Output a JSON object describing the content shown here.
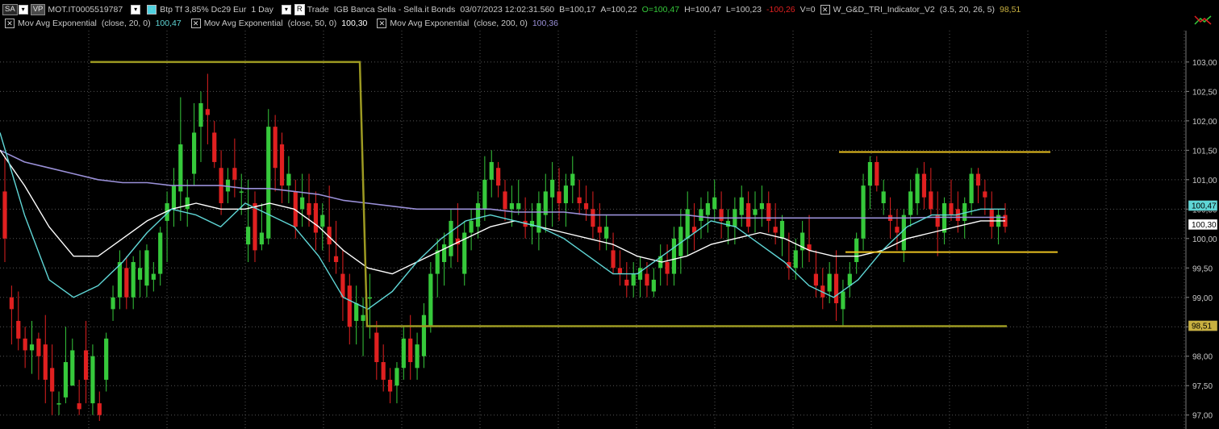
{
  "header": {
    "sa_button": "SA",
    "vp_button": "VP",
    "symbol": "MOT.IT0005519787",
    "instrument": "Btp Tf 3,85% Dc29 Eur",
    "interval": "1 Day",
    "r_button": "R",
    "trade_label": "Trade",
    "source": "IGB  Banca Sella - Sella.it  Bonds",
    "datetime": "03/07/2023   12:02:31.560",
    "bid": "B=100,17",
    "ask": "A=100,22",
    "open": "O=100,47",
    "high": "H=100,47",
    "low": "L=100,23",
    "change": "-100,26",
    "volume": "V=0",
    "indicator_name": "W_G&D_TRI_Indicator_V2",
    "indicator_params": "(3.5,  20,  26,  5)",
    "indicator_value": "98,51"
  },
  "indicators": [
    {
      "name": "Mov Avg Exponential",
      "params": "(close,  20,  0)",
      "value": "100,47",
      "color": "#5fd6d6"
    },
    {
      "name": "Mov Avg Exponential",
      "params": "(close,  50,  0)",
      "value": "100,30",
      "color": "#ffffff"
    },
    {
      "name": "Mov Avg Exponential",
      "params": "(close,  200,  0)",
      "value": "100,36",
      "color": "#9a90d8"
    }
  ],
  "price_badges": [
    {
      "value": "100,47",
      "bg": "#5fd6d6"
    },
    {
      "value": "100,30",
      "bg": "#ffffff"
    },
    {
      "value": "98,51",
      "bg": "#c8b040"
    }
  ],
  "chart_data": {
    "type": "candlestick",
    "ylim": [
      96.9,
      103.3
    ],
    "y_ticks": [
      "97,00",
      "97,50",
      "98,00",
      "98,50",
      "99,00",
      "99,50",
      "100,00",
      "100,50",
      "101,00",
      "101,50",
      "102,00",
      "102,50",
      "103,00"
    ],
    "candles": [
      [
        100.8,
        101.4,
        99.6,
        100.0
      ],
      [
        99.0,
        99.2,
        98.2,
        98.8
      ],
      [
        98.6,
        99.1,
        98.1,
        98.3
      ],
      [
        98.3,
        98.5,
        97.8,
        98.1
      ],
      [
        98.1,
        98.6,
        97.7,
        98.2
      ],
      [
        98.3,
        98.4,
        97.6,
        98.0
      ],
      [
        98.2,
        98.7,
        97.2,
        97.6
      ],
      [
        97.8,
        98.2,
        97.0,
        97.4
      ],
      [
        97.2,
        97.4,
        97.0,
        97.2
      ],
      [
        97.3,
        98.5,
        97.2,
        97.9
      ],
      [
        97.5,
        98.3,
        97.5,
        98.1
      ],
      [
        97.2,
        97.6,
        97.0,
        97.1
      ],
      [
        98.1,
        98.6,
        97.2,
        97.6
      ],
      [
        97.2,
        98.2,
        97.0,
        98.0
      ],
      [
        97.2,
        97.4,
        96.9,
        97.0
      ],
      [
        97.6,
        98.4,
        97.4,
        98.3
      ],
      [
        98.8,
        99.2,
        98.6,
        99.0
      ],
      [
        99.0,
        99.8,
        98.8,
        99.6
      ],
      [
        99.5,
        99.7,
        98.8,
        99.0
      ],
      [
        99.0,
        99.7,
        98.8,
        99.6
      ],
      [
        99.3,
        99.8,
        99.0,
        99.5
      ],
      [
        99.2,
        99.9,
        99.0,
        99.8
      ],
      [
        99.3,
        99.6,
        99.1,
        99.4
      ],
      [
        99.4,
        100.2,
        99.2,
        100.1
      ],
      [
        100.3,
        100.8,
        99.6,
        100.6
      ],
      [
        100.5,
        101.2,
        100.2,
        100.9
      ],
      [
        100.8,
        102.4,
        100.3,
        101.6
      ],
      [
        100.5,
        101.0,
        100.2,
        100.7
      ],
      [
        101.1,
        102.3,
        100.9,
        101.8
      ],
      [
        101.9,
        102.5,
        101.3,
        102.3
      ],
      [
        102.2,
        102.8,
        101.6,
        102.1
      ],
      [
        101.8,
        102.0,
        101.2,
        101.3
      ],
      [
        101.2,
        101.5,
        100.4,
        100.6
      ],
      [
        100.8,
        101.2,
        100.6,
        101.0
      ],
      [
        101.2,
        101.7,
        100.7,
        101.0
      ],
      [
        100.8,
        101.1,
        100.4,
        100.8
      ],
      [
        99.9,
        101.0,
        99.6,
        100.2
      ],
      [
        100.6,
        100.8,
        99.6,
        99.8
      ],
      [
        99.9,
        100.6,
        99.8,
        100.1
      ],
      [
        100.0,
        102.2,
        99.9,
        101.9
      ],
      [
        101.9,
        102.1,
        100.8,
        101.2
      ],
      [
        101.6,
        101.8,
        100.6,
        100.9
      ],
      [
        100.9,
        101.4,
        100.6,
        101.1
      ],
      [
        100.8,
        101.0,
        100.0,
        100.2
      ],
      [
        100.5,
        101.1,
        100.2,
        100.7
      ],
      [
        100.6,
        101.1,
        100.2,
        100.4
      ],
      [
        100.6,
        100.8,
        99.8,
        100.1
      ],
      [
        100.2,
        100.6,
        99.8,
        100.4
      ],
      [
        100.2,
        100.9,
        99.6,
        99.9
      ],
      [
        99.7,
        100.3,
        99.4,
        99.6
      ],
      [
        99.4,
        99.8,
        98.6,
        99.0
      ],
      [
        99.2,
        99.4,
        98.2,
        98.5
      ],
      [
        98.6,
        99.2,
        98.2,
        98.9
      ],
      [
        98.6,
        99.0,
        98.0,
        98.7
      ],
      [
        99.0,
        99.4,
        98.3,
        99.0
      ],
      [
        98.4,
        98.6,
        97.6,
        97.9
      ],
      [
        97.9,
        98.2,
        97.4,
        97.6
      ],
      [
        97.6,
        97.8,
        97.2,
        97.4
      ],
      [
        97.5,
        97.9,
        97.2,
        97.8
      ],
      [
        97.8,
        98.5,
        97.6,
        98.3
      ],
      [
        98.3,
        98.7,
        97.6,
        97.9
      ],
      [
        97.8,
        98.4,
        97.6,
        98.2
      ],
      [
        98.0,
        98.9,
        97.8,
        98.7
      ],
      [
        98.5,
        99.6,
        98.4,
        99.4
      ],
      [
        99.4,
        100.0,
        99.0,
        99.8
      ],
      [
        99.6,
        100.1,
        99.2,
        99.9
      ],
      [
        99.7,
        100.5,
        99.5,
        100.3
      ],
      [
        100.0,
        100.6,
        99.6,
        99.9
      ],
      [
        99.4,
        100.3,
        99.2,
        100.1
      ],
      [
        100.1,
        100.5,
        99.8,
        100.3
      ],
      [
        100.2,
        100.8,
        100.0,
        100.6
      ],
      [
        100.5,
        101.4,
        100.3,
        101.0
      ],
      [
        101.0,
        101.5,
        100.7,
        101.3
      ],
      [
        101.2,
        101.3,
        100.7,
        100.9
      ],
      [
        100.8,
        101.0,
        100.3,
        100.5
      ],
      [
        100.5,
        100.9,
        100.2,
        100.6
      ],
      [
        100.5,
        101.0,
        100.4,
        100.6
      ],
      [
        100.3,
        100.7,
        100.0,
        100.2
      ],
      [
        100.2,
        100.6,
        99.9,
        100.3
      ],
      [
        100.1,
        100.8,
        99.8,
        100.6
      ],
      [
        100.4,
        101.1,
        100.1,
        100.8
      ],
      [
        100.7,
        101.3,
        100.2,
        101.0
      ],
      [
        100.8,
        101.2,
        100.3,
        100.6
      ],
      [
        100.6,
        101.1,
        100.2,
        100.9
      ],
      [
        100.9,
        101.4,
        100.6,
        101.1
      ],
      [
        100.7,
        101.0,
        100.4,
        100.6
      ],
      [
        100.6,
        100.9,
        100.3,
        100.5
      ],
      [
        100.5,
        100.8,
        100.0,
        100.2
      ],
      [
        100.2,
        100.6,
        99.8,
        100.1
      ],
      [
        100.0,
        100.4,
        99.8,
        100.2
      ],
      [
        99.8,
        100.1,
        99.4,
        99.5
      ],
      [
        99.5,
        99.8,
        99.2,
        99.4
      ],
      [
        99.3,
        99.6,
        99.0,
        99.2
      ],
      [
        99.2,
        99.6,
        99.0,
        99.4
      ],
      [
        99.3,
        99.7,
        99.0,
        99.5
      ],
      [
        99.4,
        99.6,
        99.0,
        99.2
      ],
      [
        99.1,
        99.5,
        99.0,
        99.3
      ],
      [
        99.5,
        99.9,
        99.2,
        99.7
      ],
      [
        99.6,
        99.9,
        99.2,
        99.4
      ],
      [
        99.4,
        100.2,
        99.2,
        100.0
      ],
      [
        99.7,
        100.5,
        99.4,
        100.2
      ],
      [
        100.0,
        100.8,
        99.7,
        100.5
      ],
      [
        100.2,
        100.6,
        99.8,
        100.1
      ],
      [
        100.3,
        100.7,
        100.0,
        100.5
      ],
      [
        100.4,
        100.8,
        100.1,
        100.6
      ],
      [
        100.5,
        101.0,
        100.3,
        100.7
      ],
      [
        100.5,
        100.8,
        100.0,
        100.3
      ],
      [
        100.2,
        100.5,
        99.9,
        100.3
      ],
      [
        100.2,
        100.7,
        99.9,
        100.5
      ],
      [
        100.4,
        100.9,
        100.2,
        100.7
      ],
      [
        100.6,
        100.8,
        100.1,
        100.2
      ],
      [
        100.4,
        100.8,
        100.1,
        100.5
      ],
      [
        100.5,
        100.9,
        100.2,
        100.6
      ],
      [
        100.6,
        100.8,
        100.1,
        100.3
      ],
      [
        100.2,
        100.6,
        99.9,
        100.1
      ],
      [
        100.0,
        100.4,
        99.7,
        100.3
      ],
      [
        99.6,
        100.1,
        99.3,
        99.5
      ],
      [
        99.5,
        100.0,
        99.3,
        99.8
      ],
      [
        99.8,
        100.3,
        99.5,
        100.1
      ],
      [
        99.9,
        100.4,
        99.6,
        99.8
      ],
      [
        99.4,
        99.8,
        99.0,
        99.2
      ],
      [
        99.2,
        99.5,
        98.8,
        99.0
      ],
      [
        99.1,
        99.6,
        98.9,
        99.4
      ],
      [
        99.4,
        99.8,
        98.6,
        98.9
      ],
      [
        98.8,
        99.3,
        98.5,
        99.1
      ],
      [
        99.2,
        99.6,
        99.0,
        99.4
      ],
      [
        99.6,
        100.1,
        99.4,
        100.0
      ],
      [
        100.0,
        101.1,
        99.8,
        100.9
      ],
      [
        100.9,
        101.4,
        100.5,
        101.3
      ],
      [
        101.3,
        101.4,
        100.8,
        100.9
      ],
      [
        100.6,
        101.0,
        100.4,
        100.8
      ],
      [
        100.4,
        100.7,
        100.0,
        100.3
      ],
      [
        100.2,
        100.5,
        99.8,
        100.1
      ],
      [
        99.8,
        100.5,
        99.6,
        100.4
      ],
      [
        100.4,
        101.0,
        100.2,
        100.8
      ],
      [
        100.6,
        101.2,
        100.4,
        101.1
      ],
      [
        101.1,
        101.3,
        100.5,
        100.7
      ],
      [
        100.8,
        101.2,
        100.4,
        100.5
      ],
      [
        100.4,
        100.8,
        99.7,
        100.2
      ],
      [
        100.1,
        100.7,
        99.9,
        100.6
      ],
      [
        100.6,
        101.0,
        100.3,
        100.4
      ],
      [
        100.5,
        100.8,
        100.1,
        100.3
      ],
      [
        100.3,
        100.7,
        100.0,
        100.6
      ],
      [
        100.6,
        101.2,
        100.4,
        101.1
      ],
      [
        101.1,
        101.2,
        100.6,
        100.9
      ],
      [
        100.8,
        101.0,
        100.4,
        100.7
      ],
      [
        100.5,
        100.8,
        100.0,
        100.2
      ],
      [
        100.2,
        100.5,
        99.9,
        100.4
      ],
      [
        100.4,
        100.6,
        100.1,
        100.2
      ]
    ],
    "ema_20": [
      101.8,
      100.4,
      99.3,
      99.0,
      99.2,
      99.6,
      100.1,
      100.5,
      100.4,
      100.2,
      100.6,
      100.4,
      100.2,
      99.7,
      99.0,
      98.8,
      99.1,
      99.6,
      100.0,
      100.3,
      100.4,
      100.3,
      100.2,
      100.0,
      99.7,
      99.4,
      99.4,
      99.7,
      100.0,
      100.3,
      100.2,
      99.9,
      99.6,
      99.2,
      99.0,
      99.3,
      99.8,
      100.2,
      100.4,
      100.4,
      100.5,
      100.5
    ],
    "ema_50": [
      101.5,
      100.9,
      100.2,
      99.7,
      99.7,
      100.0,
      100.3,
      100.5,
      100.6,
      100.5,
      100.5,
      100.6,
      100.5,
      100.2,
      99.8,
      99.5,
      99.4,
      99.6,
      99.8,
      100.0,
      100.2,
      100.3,
      100.2,
      100.1,
      100.0,
      99.9,
      99.7,
      99.6,
      99.7,
      99.9,
      100.0,
      100.1,
      100.0,
      99.8,
      99.7,
      99.7,
      99.8,
      100.0,
      100.1,
      100.2,
      100.3,
      100.3
    ],
    "ema_200": [
      101.5,
      101.3,
      101.2,
      101.1,
      101.0,
      100.95,
      100.95,
      100.9,
      100.9,
      100.9,
      100.85,
      100.85,
      100.8,
      100.75,
      100.65,
      100.6,
      100.55,
      100.5,
      100.5,
      100.5,
      100.5,
      100.45,
      100.45,
      100.45,
      100.4,
      100.4,
      100.4,
      100.4,
      100.4,
      100.35,
      100.35,
      100.35,
      100.35,
      100.35,
      100.35,
      100.35,
      100.35,
      100.35,
      100.36,
      100.36,
      100.36,
      100.36
    ],
    "tri_indicator": [
      103.0,
      103.0,
      103.0,
      103.0,
      103.0,
      103.0,
      103.0,
      103.0,
      103.0,
      103.0,
      98.51,
      98.51,
      98.51,
      98.51,
      98.51,
      98.51,
      98.51,
      98.51,
      98.51,
      98.51,
      98.51,
      98.51,
      98.51,
      98.51,
      98.51,
      98.51,
      98.51,
      98.51,
      98.51,
      98.51,
      98.51,
      98.51,
      98.51,
      98.51,
      98.51,
      98.51,
      98.51,
      98.51,
      98.51,
      98.51,
      98.51,
      98.51
    ],
    "resistance_level": 101.47,
    "support_level": 99.77,
    "colors": {
      "up": "#36c93b",
      "down": "#e02020",
      "ema20": "#5fd6d6",
      "ema50": "#ffffff",
      "ema200": "#9a90d8",
      "tri": "#9d9a22",
      "levels": "#e8c020",
      "grid": "#555555"
    }
  }
}
